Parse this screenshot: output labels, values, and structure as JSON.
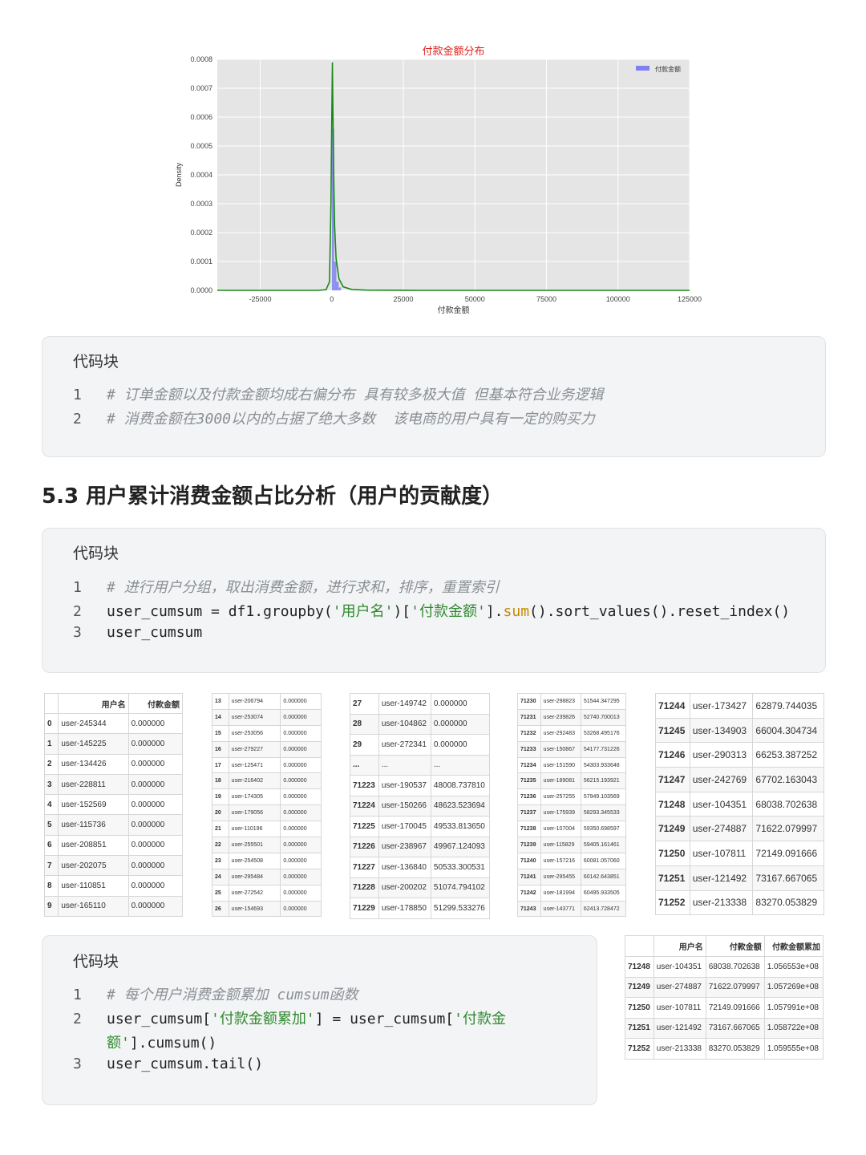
{
  "chart_data": {
    "type": "histogram",
    "title": "付款金额分布",
    "xlabel": "付款金额",
    "ylabel": "Density",
    "xlim": [
      -40000,
      125000
    ],
    "ylim": [
      0,
      0.0008
    ],
    "xticks": [
      -25000,
      0,
      25000,
      50000,
      75000,
      100000,
      125000
    ],
    "yticks": [
      "0.0000",
      "0.0001",
      "0.0002",
      "0.0003",
      "0.0004",
      "0.0005",
      "0.0006",
      "0.0007",
      "0.0008"
    ],
    "legend": {
      "label": "付款金额",
      "position": "top-right"
    },
    "grid": true,
    "histogram_bars": [
      {
        "x0": 0,
        "x1": 800,
        "density": 0.00056
      },
      {
        "x0": 800,
        "x1": 1600,
        "density": 0.0001
      },
      {
        "x0": 1600,
        "x1": 2400,
        "density": 3e-05
      },
      {
        "x0": 2400,
        "x1": 3200,
        "density": 1e-05
      }
    ],
    "kde_line": {
      "color": "#1a8a1a",
      "x": [
        -40000,
        -5000,
        -2000,
        -800,
        -300,
        0,
        200,
        400,
        700,
        1000,
        1500,
        2500,
        4000,
        7000,
        12000,
        30000,
        125000
      ],
      "y": [
        0,
        0,
        2e-06,
        3e-05,
        0.0003,
        0.0006,
        0.00079,
        0.00062,
        0.00038,
        0.00022,
        0.00011,
        4e-05,
        1.2e-05,
        3e-06,
        1e-06,
        0,
        0
      ]
    },
    "colors": {
      "bars": "#8080f0",
      "background": "#e5e5e5",
      "grid": "#ffffff",
      "title": "#e0201a"
    }
  },
  "block1": {
    "title": "代码块",
    "lines": [
      {
        "num": "1",
        "comment": "# 订单金额以及付款金额均成右偏分布 具有较多极大值 但基本符合业务逻辑"
      },
      {
        "num": "2",
        "comment": "# 消费金额在3000以内的占据了绝大多数  该电商的用户具有一定的购买力"
      }
    ]
  },
  "section": {
    "heading": "5.3 用户累计消费金额占比分析（用户的贡献度）"
  },
  "block2": {
    "title": "代码块",
    "line1": {
      "num": "1",
      "comment": "# 进行用户分组，取出消费金额，进行求和，排序，重置索引"
    },
    "line2": {
      "num": "2",
      "p1": "user_cumsum = df1.groupby(",
      "s1": "'用户名'",
      "p2": ")[",
      "s2": "'付款金额'",
      "p3": "].",
      "fn": "sum",
      "p4": "().sort_values().reset_index()"
    },
    "line3": {
      "num": "3",
      "text": "user_cumsum"
    }
  },
  "block3": {
    "title": "代码块",
    "line1": {
      "num": "1",
      "comment": "# 每个用户消费金额累加 cumsum函数"
    },
    "line2": {
      "num": "2",
      "p1": "user_cumsum[",
      "s1": "'付款金额累加'",
      "p2": "] = user_cumsum[",
      "s2": "'付款金"
    },
    "line2b": {
      "s3": "额'",
      "p3": "].cumsum()"
    },
    "line3": {
      "num": "3",
      "text": "user_cumsum.tail()"
    }
  },
  "table1": {
    "headers": [
      "",
      "用户名",
      "付款金额"
    ],
    "rows": [
      [
        "0",
        "user-245344",
        "0.000000"
      ],
      [
        "1",
        "user-145225",
        "0.000000"
      ],
      [
        "2",
        "user-134426",
        "0.000000"
      ],
      [
        "3",
        "user-228811",
        "0.000000"
      ],
      [
        "4",
        "user-152569",
        "0.000000"
      ],
      [
        "5",
        "user-115736",
        "0.000000"
      ],
      [
        "6",
        "user-208851",
        "0.000000"
      ],
      [
        "7",
        "user-202075",
        "0.000000"
      ],
      [
        "8",
        "user-110851",
        "0.000000"
      ],
      [
        "9",
        "user-165110",
        "0.000000"
      ]
    ]
  },
  "table2": {
    "rows": [
      [
        "13",
        "user-206794",
        "0.000000"
      ],
      [
        "14",
        "user-253074",
        "0.000000"
      ],
      [
        "15",
        "user-253056",
        "0.000000"
      ],
      [
        "16",
        "user-279227",
        "0.000000"
      ],
      [
        "17",
        "user-125471",
        "0.000000"
      ],
      [
        "18",
        "user-216402",
        "0.000000"
      ],
      [
        "19",
        "user-174305",
        "0.000000"
      ],
      [
        "20",
        "user-179056",
        "0.000000"
      ],
      [
        "21",
        "user-110196",
        "0.000000"
      ],
      [
        "22",
        "user-255501",
        "0.000000"
      ],
      [
        "23",
        "user-254508",
        "0.000000"
      ],
      [
        "24",
        "user-295484",
        "0.000000"
      ],
      [
        "25",
        "user-272542",
        "0.000000"
      ],
      [
        "26",
        "user-154693",
        "0.000000"
      ]
    ]
  },
  "table3": {
    "rows": [
      [
        "27",
        "user-149742",
        "0.000000"
      ],
      [
        "28",
        "user-104862",
        "0.000000"
      ],
      [
        "29",
        "user-272341",
        "0.000000"
      ],
      [
        "...",
        "...",
        "..."
      ],
      [
        "71223",
        "user-190537",
        "48008.737810"
      ],
      [
        "71224",
        "user-150266",
        "48623.523694"
      ],
      [
        "71225",
        "user-170045",
        "49533.813650"
      ],
      [
        "71226",
        "user-238967",
        "49967.124093"
      ],
      [
        "71227",
        "user-136840",
        "50533.300531"
      ],
      [
        "71228",
        "user-200202",
        "51074.794102"
      ],
      [
        "71229",
        "user-178850",
        "51299.533276"
      ]
    ]
  },
  "table4": {
    "rows": [
      [
        "71230",
        "user-298823",
        "51544.347295"
      ],
      [
        "71231",
        "user-239826",
        "52740.700013"
      ],
      [
        "71232",
        "user-292483",
        "53268.495176"
      ],
      [
        "71233",
        "user-150867",
        "54177.731226"
      ],
      [
        "71234",
        "user-151590",
        "54303.933648"
      ],
      [
        "71235",
        "user-189081",
        "56215.193921"
      ],
      [
        "71236",
        "user-257255",
        "57949.103569"
      ],
      [
        "71237",
        "user-175939",
        "58293.345533"
      ],
      [
        "71238",
        "user-107004",
        "59350.698597"
      ],
      [
        "71239",
        "user-115829",
        "59405.161461"
      ],
      [
        "71240",
        "user-157216",
        "60081.057060"
      ],
      [
        "71241",
        "user-295455",
        "60142.643851"
      ],
      [
        "71242",
        "user-181994",
        "60495.933505"
      ],
      [
        "71243",
        "user-143771",
        "62413.728472"
      ]
    ]
  },
  "table5": {
    "rows": [
      [
        "71244",
        "user-173427",
        "62879.744035"
      ],
      [
        "71245",
        "user-134903",
        "66004.304734"
      ],
      [
        "71246",
        "user-290313",
        "66253.387252"
      ],
      [
        "71247",
        "user-242769",
        "67702.163043"
      ],
      [
        "71248",
        "user-104351",
        "68038.702638"
      ],
      [
        "71249",
        "user-274887",
        "71622.079997"
      ],
      [
        "71250",
        "user-107811",
        "72149.091666"
      ],
      [
        "71251",
        "user-121492",
        "73167.667065"
      ],
      [
        "71252",
        "user-213338",
        "83270.053829"
      ]
    ]
  },
  "table6": {
    "headers": [
      "",
      "用户名",
      "付款金额",
      "付款金额累加"
    ],
    "rows": [
      [
        "71248",
        "user-104351",
        "68038.702638",
        "1.056553e+08"
      ],
      [
        "71249",
        "user-274887",
        "71622.079997",
        "1.057269e+08"
      ],
      [
        "71250",
        "user-107811",
        "72149.091666",
        "1.057991e+08"
      ],
      [
        "71251",
        "user-121492",
        "73167.667065",
        "1.058722e+08"
      ],
      [
        "71252",
        "user-213338",
        "83270.053829",
        "1.059555e+08"
      ]
    ]
  }
}
